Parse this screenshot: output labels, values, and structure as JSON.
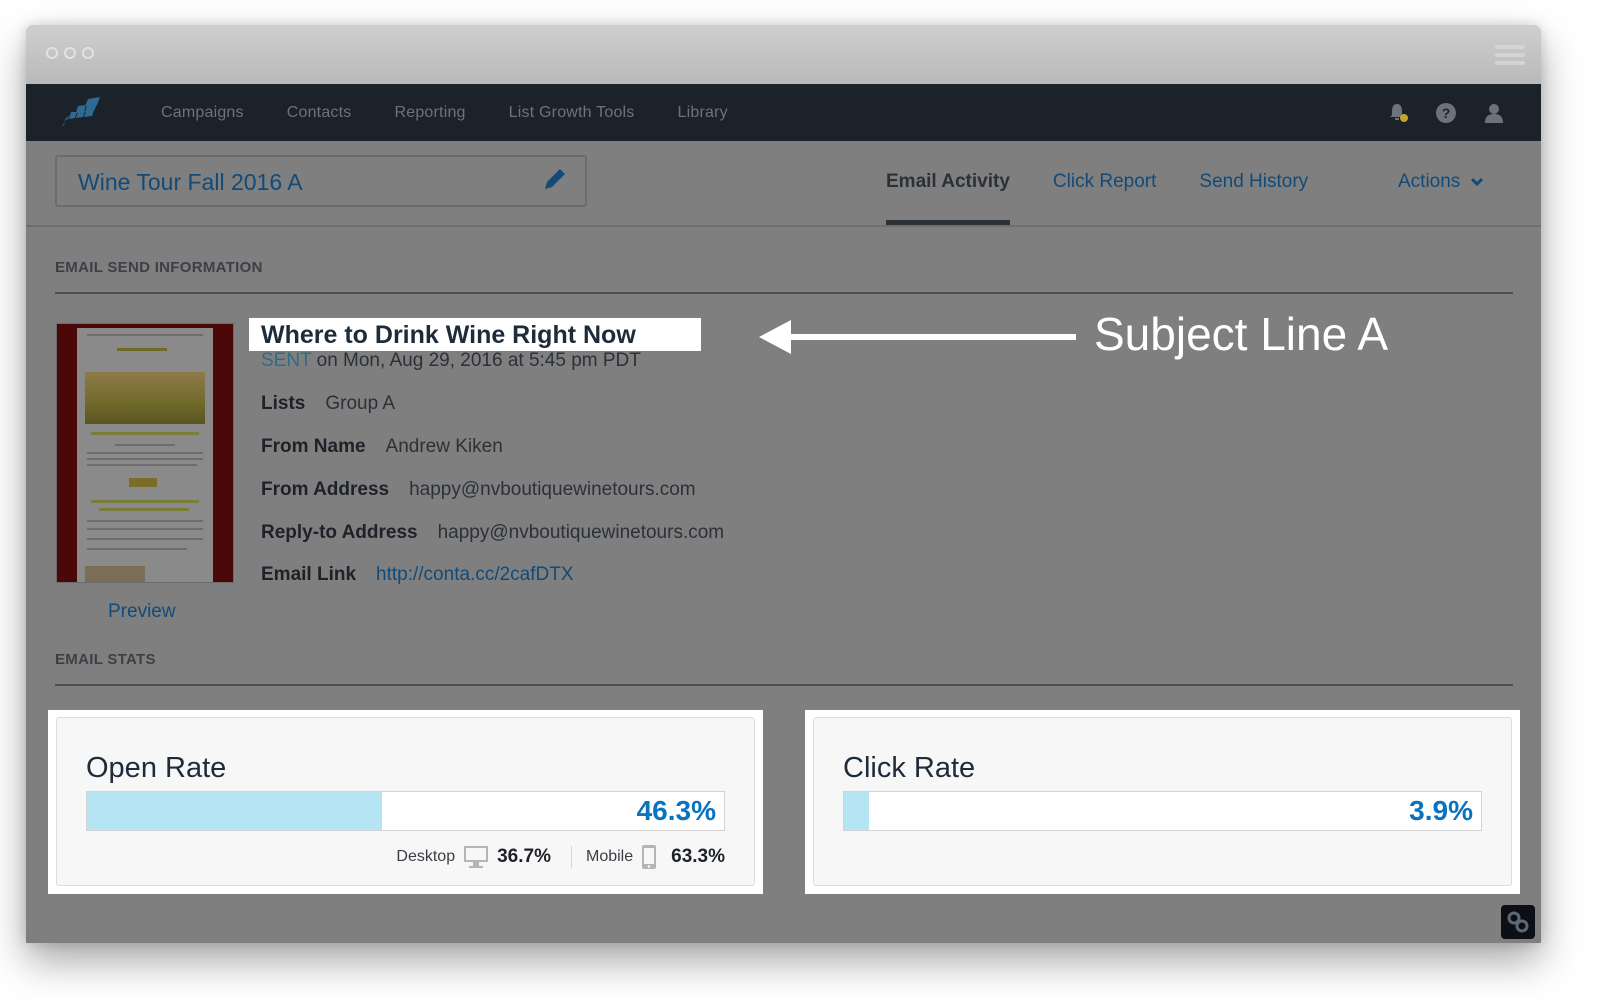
{
  "window": {
    "titlebar_dots": 3
  },
  "nav": {
    "logo": "constant-contact-logo",
    "items": [
      {
        "label": "Campaigns"
      },
      {
        "label": "Contacts"
      },
      {
        "label": "Reporting"
      },
      {
        "label": "List Growth Tools"
      },
      {
        "label": "Library"
      }
    ],
    "icons": [
      "bell-icon",
      "help-icon",
      "user-icon"
    ],
    "notification_dot_color": "#c9a227"
  },
  "campaign": {
    "name": "Wine Tour Fall 2016 A",
    "edit_icon": "pencil-icon"
  },
  "tabs": [
    {
      "label": "Email Activity",
      "active": true
    },
    {
      "label": "Click Report",
      "active": false
    },
    {
      "label": "Send History",
      "active": false
    }
  ],
  "actions": {
    "label": "Actions"
  },
  "send_info": {
    "section_label": "EMAIL SEND INFORMATION",
    "subject": "Where to Drink Wine Right Now",
    "sent_word": "SENT",
    "sent_detail": " on Mon, Aug 29, 2016 at 5:45 pm PDT",
    "rows": [
      {
        "label": "Lists",
        "value": "Group A"
      },
      {
        "label": "From Name",
        "value": "Andrew Kiken"
      },
      {
        "label": "From Address",
        "value": "happy@nvboutiquewinetours.com"
      },
      {
        "label": "Reply-to Address",
        "value": "happy@nvboutiquewinetours.com"
      },
      {
        "label": "Email Link",
        "value": "http://conta.cc/2cafDTX"
      }
    ],
    "preview_label": "Preview"
  },
  "annotation": {
    "text": "Subject Line A"
  },
  "stats": {
    "section_label": "EMAIL STATS",
    "open_rate": {
      "title": "Open Rate",
      "value_label": "46.3%",
      "fill_percent": 46.3,
      "desktop_label": "Desktop",
      "desktop_value": "36.7%",
      "mobile_label": "Mobile",
      "mobile_value": "63.3%"
    },
    "click_rate": {
      "title": "Click Rate",
      "value_label": "3.9%",
      "fill_percent": 3.9
    },
    "bar_fill_color": "#b5e4f3",
    "value_color": "#0a73c0"
  }
}
